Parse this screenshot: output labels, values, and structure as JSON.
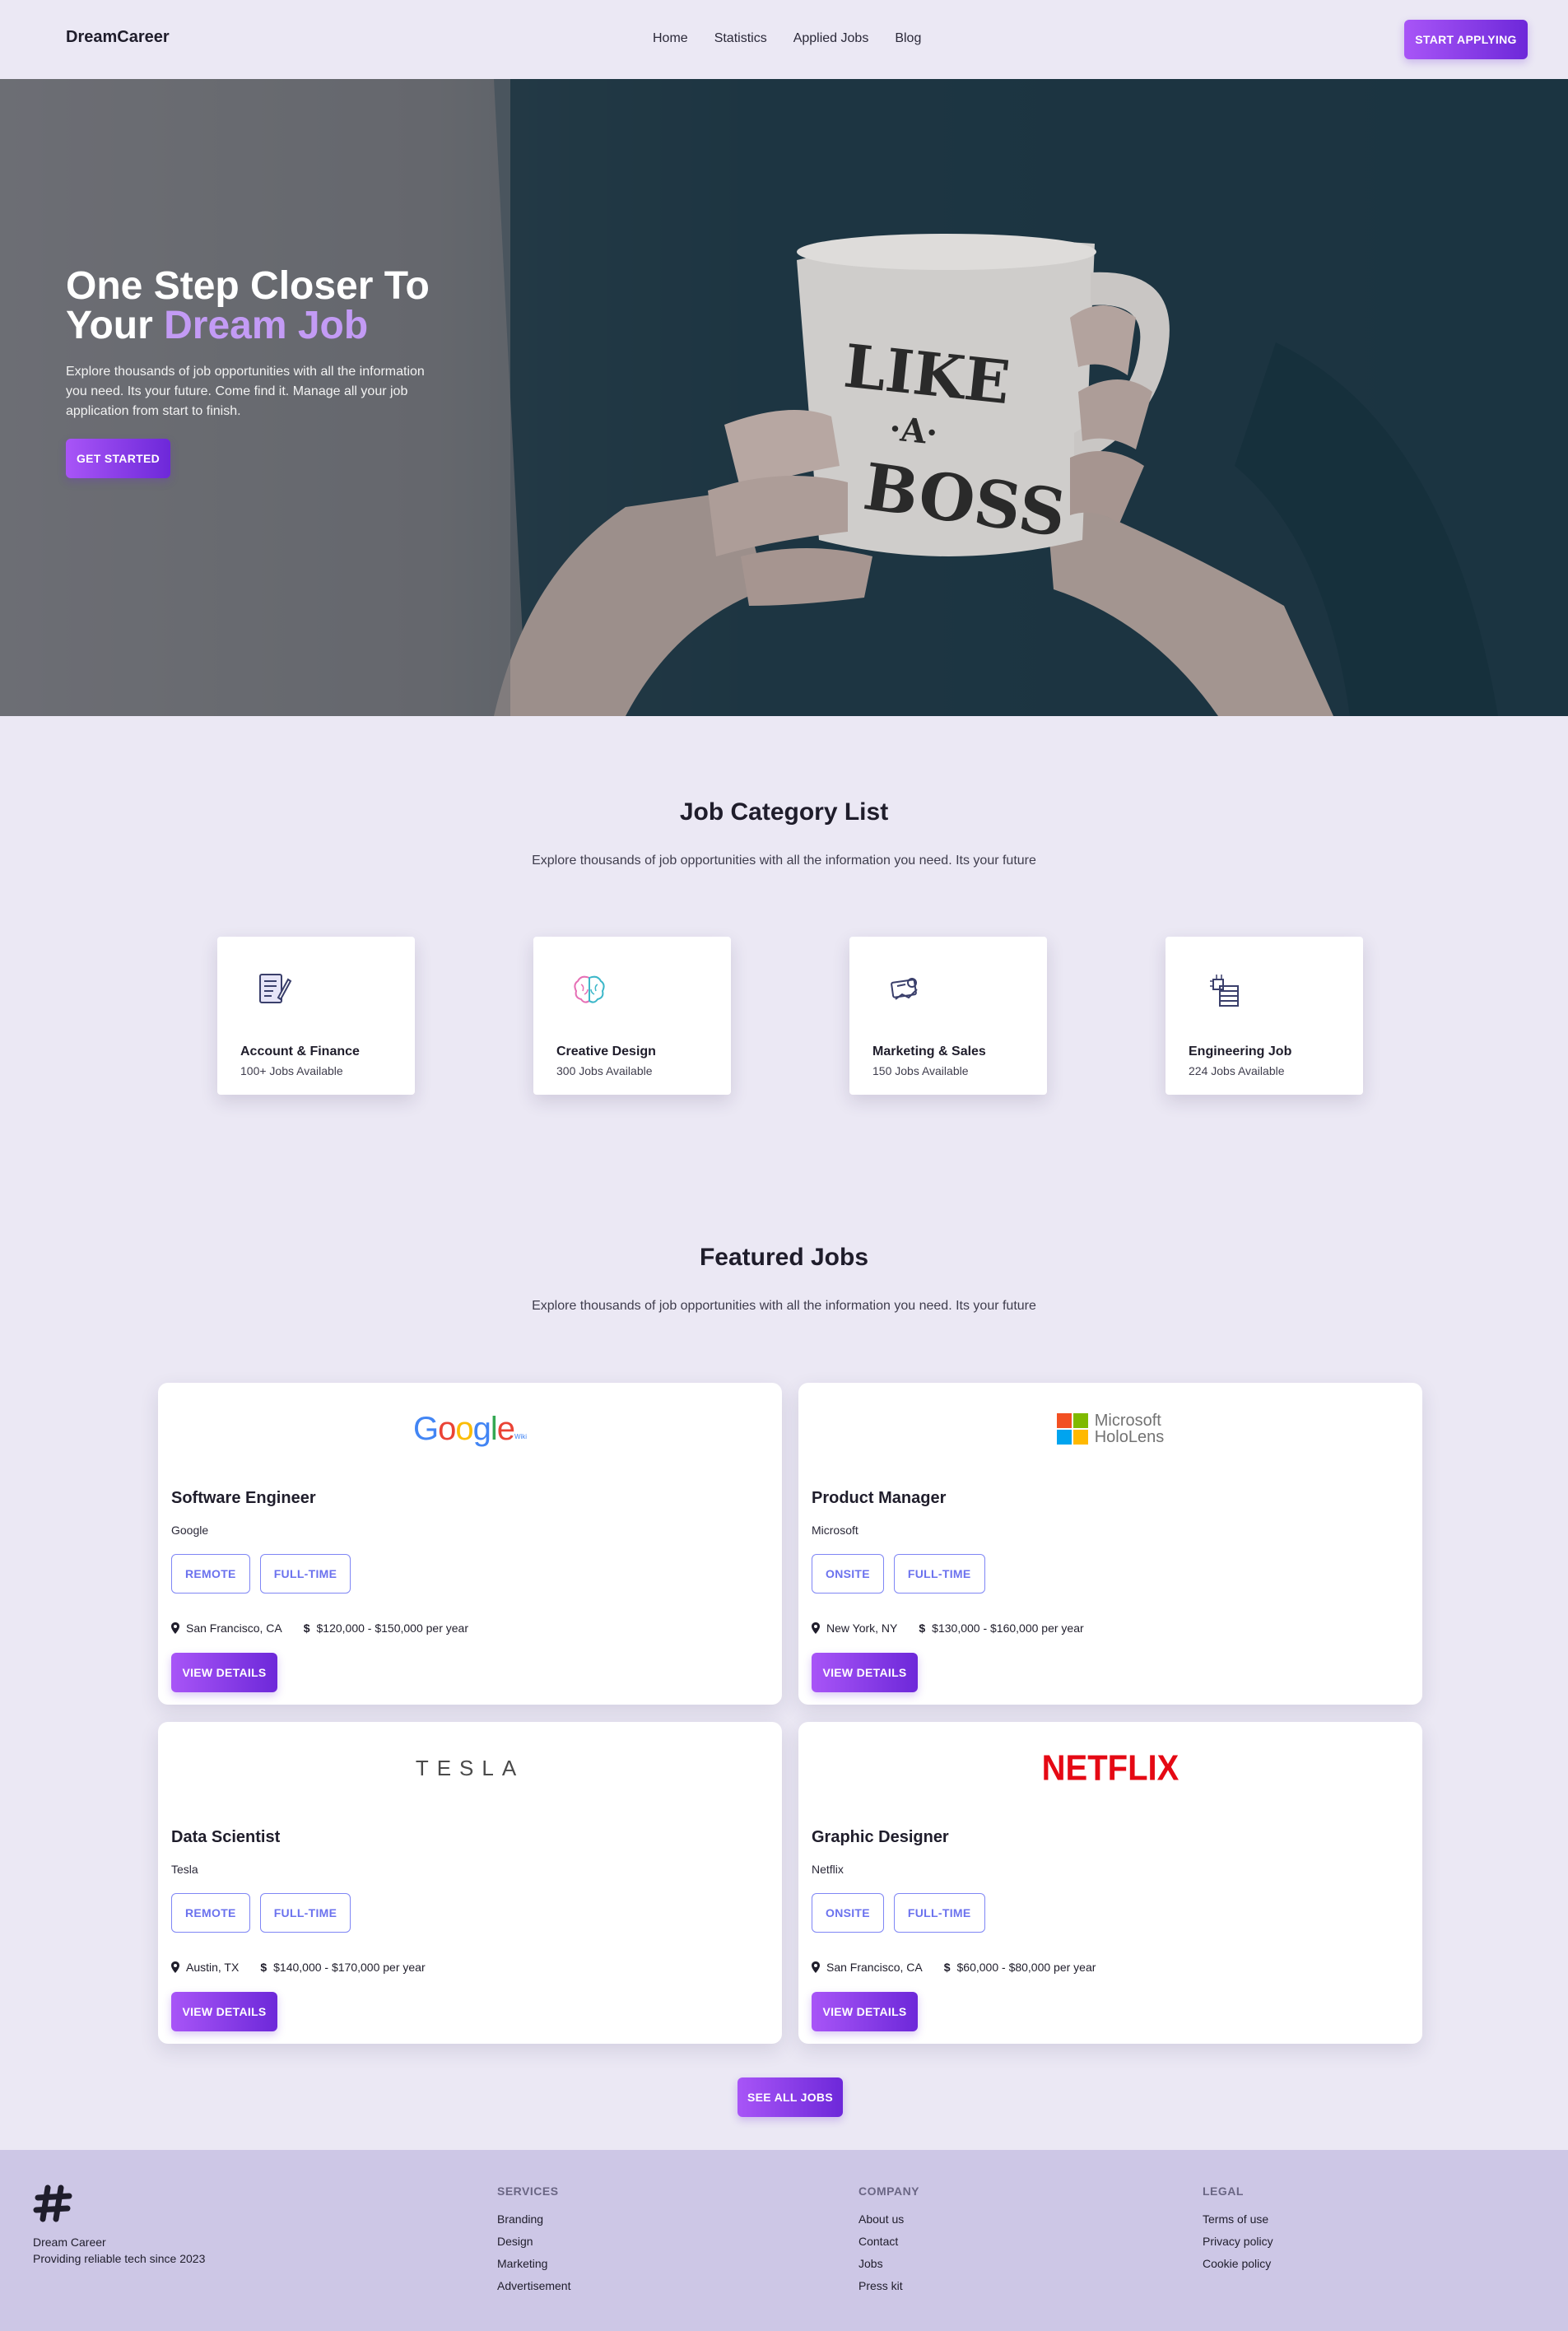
{
  "nav": {
    "brand": "DreamCareer",
    "links": [
      "Home",
      "Statistics",
      "Applied Jobs",
      "Blog"
    ],
    "cta": "START APPLYING"
  },
  "hero": {
    "title_line1": "One Step Closer To",
    "title_prefix": "Your ",
    "title_accent": "Dream Job",
    "subtitle": "Explore thousands of job opportunities with all the information you need. Its your future. Come find it. Manage all your job application from start to finish.",
    "cta": "GET STARTED",
    "mug_text": [
      "LIKE",
      "·A·",
      "BOSS"
    ]
  },
  "categories": {
    "title": "Job Category List",
    "subtitle": "Explore thousands of job opportunities with all the information you need. Its your future",
    "items": [
      {
        "name": "Account & Finance",
        "count": "100+ Jobs Available",
        "icon": "document-icon"
      },
      {
        "name": "Creative Design",
        "count": "300 Jobs Available",
        "icon": "brain-icon"
      },
      {
        "name": "Marketing & Sales",
        "count": "150 Jobs Available",
        "icon": "marketing-icon"
      },
      {
        "name": "Engineering Job",
        "count": "224 Jobs Available",
        "icon": "server-chip-icon"
      }
    ]
  },
  "featured": {
    "title": "Featured Jobs",
    "subtitle": "Explore thousands of job opportunities with all the information you need. Its your future",
    "jobs": [
      {
        "title": "Software Engineer",
        "company": "Google",
        "logo_text": "Google",
        "logo_sub": "Wiki",
        "tags": [
          "REMOTE",
          "FULL-TIME"
        ],
        "location": "San Francisco, CA",
        "salary": "$120,000 - $150,000 per year",
        "button": "VIEW DETAILS"
      },
      {
        "title": "Product Manager",
        "company": "Microsoft",
        "logo_text": "Microsoft",
        "logo_sub": "HoloLens",
        "tags": [
          "ONSITE",
          "FULL-TIME"
        ],
        "location": "New York, NY",
        "salary": "$130,000 - $160,000 per year",
        "button": "VIEW DETAILS"
      },
      {
        "title": "Data Scientist",
        "company": "Tesla",
        "logo_text": "TESLA",
        "tags": [
          "REMOTE",
          "FULL-TIME"
        ],
        "location": "Austin, TX",
        "salary": "$140,000 - $170,000 per year",
        "button": "VIEW DETAILS"
      },
      {
        "title": "Graphic Designer",
        "company": "Netflix",
        "logo_text": "NETFLIX",
        "tags": [
          "ONSITE",
          "FULL-TIME"
        ],
        "location": "San Francisco, CA",
        "salary": "$60,000 - $80,000 per year",
        "button": "VIEW DETAILS"
      }
    ],
    "see_all": "SEE ALL JOBS"
  },
  "footer": {
    "name": "Dream Career",
    "tagline": "Providing reliable tech since 2023",
    "columns": [
      {
        "heading": "SERVICES",
        "links": [
          "Branding",
          "Design",
          "Marketing",
          "Advertisement"
        ]
      },
      {
        "heading": "COMPANY",
        "links": [
          "About us",
          "Contact",
          "Jobs",
          "Press kit"
        ]
      },
      {
        "heading": "LEGAL",
        "links": [
          "Terms of use",
          "Privacy policy",
          "Cookie policy"
        ]
      }
    ]
  },
  "colors": {
    "accent_start": "#a855f7",
    "accent_end": "#6d28d9",
    "tag_border": "#7f86f5",
    "page_bg": "#ebe8f4",
    "footer_bg": "#cdc7e6"
  }
}
